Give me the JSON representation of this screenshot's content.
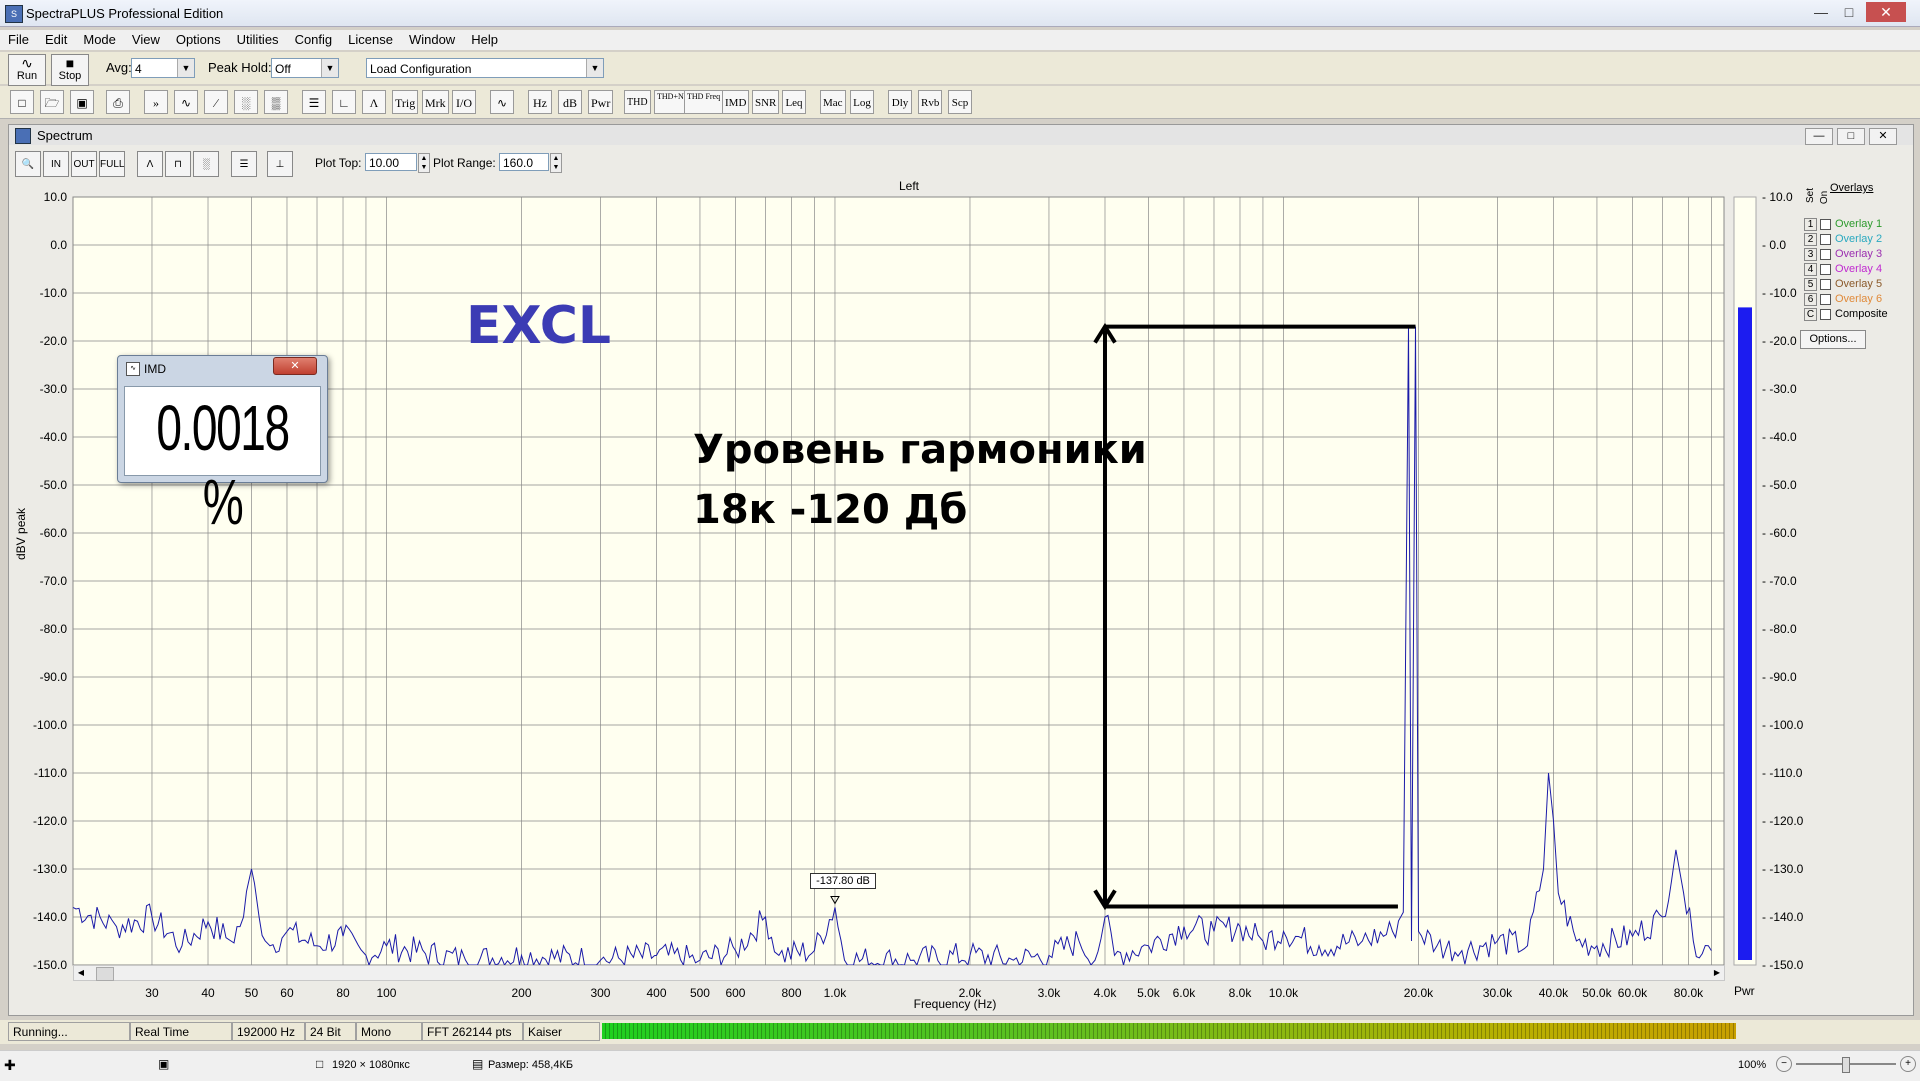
{
  "app": {
    "title": "SpectraPLUS Professional Edition"
  },
  "menu": [
    "File",
    "Edit",
    "Mode",
    "View",
    "Options",
    "Utilities",
    "Config",
    "License",
    "Window",
    "Help"
  ],
  "toolbar": {
    "run_label": "Run",
    "stop_label": "Stop",
    "avg_label": "Avg:",
    "avg_value": "4",
    "peak_hold_label": "Peak Hold:",
    "peak_hold_value": "Off",
    "config_value": "Load Configuration",
    "buttons2": [
      "Trig",
      "Mrk",
      "I/O",
      "Hz",
      "dB",
      "Pwr",
      "THD",
      "THD+N",
      "THD Freq",
      "IMD",
      "SNR",
      "Leq",
      "Mac",
      "Log",
      "Dly",
      "Rvb",
      "Scp"
    ]
  },
  "spectrum": {
    "window_title": "Spectrum",
    "plot_top_label": "Plot Top:",
    "plot_top_value": "10.00",
    "plot_range_label": "Plot Range:",
    "plot_range_value": "160.0",
    "channel_label": "Left",
    "xlabel": "Frequency (Hz)",
    "ylabel": "dBV peak",
    "pwr_label": "Pwr",
    "marker_label": "-137.80 dB"
  },
  "imd": {
    "title": "IMD",
    "value": "0.0018 %"
  },
  "annotations": {
    "brand": "EXCL",
    "note_line1": "Уровень гармоники",
    "note_line2": "18к -120 Дб"
  },
  "overlays": {
    "title": "Overlays",
    "set_label": "Set",
    "on_label": "On",
    "options_label": "Options...",
    "items": [
      {
        "num": "1",
        "label": "Overlay 1",
        "color": "#2e9b2e"
      },
      {
        "num": "2",
        "label": "Overlay 2",
        "color": "#2aa9c0"
      },
      {
        "num": "3",
        "label": "Overlay 3",
        "color": "#9b2fb0"
      },
      {
        "num": "4",
        "label": "Overlay 4",
        "color": "#c02ad0"
      },
      {
        "num": "5",
        "label": "Overlay 5",
        "color": "#8b5a2b"
      },
      {
        "num": "6",
        "label": "Overlay 6",
        "color": "#e08a3a"
      },
      {
        "num": "C",
        "label": "Composite",
        "color": "#000000"
      }
    ]
  },
  "status": {
    "state": "Running...",
    "mode": "Real Time",
    "rate": "192000 Hz",
    "bits": "24 Bit",
    "channels": "Mono",
    "fft": "FFT 262144 pts",
    "window": "Kaiser"
  },
  "bottom": {
    "dims": "1920 × 1080пкс",
    "size": "Размер: 458,4КБ",
    "zoom": "100%"
  },
  "chart_data": {
    "type": "line",
    "title": "",
    "xlabel": "Frequency (Hz)",
    "ylabel": "dBV peak",
    "xscale": "log",
    "xlim": [
      20,
      96000
    ],
    "ylim": [
      -150,
      10
    ],
    "y_ticks": [
      "10.0",
      "0.0",
      "-10.0",
      "-20.0",
      "-30.0",
      "-40.0",
      "-50.0",
      "-60.0",
      "-70.0",
      "-80.0",
      "-90.0",
      "-100.0",
      "-110.0",
      "-120.0",
      "-130.0",
      "-140.0",
      "-150.0"
    ],
    "x_ticks": [
      {
        "v": 30,
        "label": "30"
      },
      {
        "v": 40,
        "label": "40"
      },
      {
        "v": 50,
        "label": "50"
      },
      {
        "v": 60,
        "label": "60"
      },
      {
        "v": 80,
        "label": "80"
      },
      {
        "v": 100,
        "label": "100"
      },
      {
        "v": 200,
        "label": "200"
      },
      {
        "v": 300,
        "label": "300"
      },
      {
        "v": 400,
        "label": "400"
      },
      {
        "v": 500,
        "label": "500"
      },
      {
        "v": 600,
        "label": "600"
      },
      {
        "v": 800,
        "label": "800"
      },
      {
        "v": 1000,
        "label": "1.0k"
      },
      {
        "v": 2000,
        "label": "2.0k"
      },
      {
        "v": 3000,
        "label": "3.0k"
      },
      {
        "v": 4000,
        "label": "4.0k"
      },
      {
        "v": 5000,
        "label": "5.0k"
      },
      {
        "v": 6000,
        "label": "6.0k"
      },
      {
        "v": 8000,
        "label": "8.0k"
      },
      {
        "v": 10000,
        "label": "10.0k"
      },
      {
        "v": 20000,
        "label": "20.0k"
      },
      {
        "v": 30000,
        "label": "30.0k"
      },
      {
        "v": 40000,
        "label": "40.0k"
      },
      {
        "v": 50000,
        "label": "50.0k"
      },
      {
        "v": 60000,
        "label": "60.0k"
      },
      {
        "v": 80000,
        "label": "80.0k"
      }
    ],
    "series": [
      {
        "color": "#1a1aa8",
        "points": [
          [
            20,
            -138
          ],
          [
            25,
            -142
          ],
          [
            30,
            -140
          ],
          [
            35,
            -146
          ],
          [
            40,
            -141
          ],
          [
            45,
            -145
          ],
          [
            48,
            -140
          ],
          [
            50,
            -130
          ],
          [
            52,
            -140
          ],
          [
            55,
            -146
          ],
          [
            60,
            -143
          ],
          [
            70,
            -146
          ],
          [
            80,
            -144
          ],
          [
            90,
            -148
          ],
          [
            100,
            -146
          ],
          [
            150,
            -149
          ],
          [
            200,
            -148
          ],
          [
            300,
            -149
          ],
          [
            400,
            -148
          ],
          [
            500,
            -149
          ],
          [
            600,
            -147
          ],
          [
            700,
            -140
          ],
          [
            750,
            -148
          ],
          [
            900,
            -147
          ],
          [
            1000,
            -138
          ],
          [
            1050,
            -149
          ],
          [
            1500,
            -149
          ],
          [
            2000,
            -148
          ],
          [
            2500,
            -149
          ],
          [
            3000,
            -148
          ],
          [
            3500,
            -145
          ],
          [
            3800,
            -149
          ],
          [
            4000,
            -140
          ],
          [
            4200,
            -148
          ],
          [
            5000,
            -146
          ],
          [
            6000,
            -142
          ],
          [
            7000,
            -143
          ],
          [
            8000,
            -142
          ],
          [
            9000,
            -145
          ],
          [
            10000,
            -143
          ],
          [
            12000,
            -146
          ],
          [
            15000,
            -145
          ],
          [
            17500,
            -143
          ],
          [
            18500,
            -139
          ],
          [
            19000,
            -17
          ],
          [
            19300,
            -145
          ],
          [
            19700,
            -17
          ],
          [
            20000,
            -143
          ],
          [
            22000,
            -146
          ],
          [
            25000,
            -147
          ],
          [
            30000,
            -145
          ],
          [
            35000,
            -146
          ],
          [
            38000,
            -130
          ],
          [
            39000,
            -110
          ],
          [
            40000,
            -120
          ],
          [
            41000,
            -135
          ],
          [
            45000,
            -145
          ],
          [
            50000,
            -146
          ],
          [
            60000,
            -144
          ],
          [
            70000,
            -140
          ],
          [
            75000,
            -126
          ],
          [
            78000,
            -135
          ],
          [
            82000,
            -145
          ],
          [
            90000,
            -147
          ]
        ]
      }
    ],
    "meter": {
      "label": "Pwr",
      "value": -13
    }
  }
}
